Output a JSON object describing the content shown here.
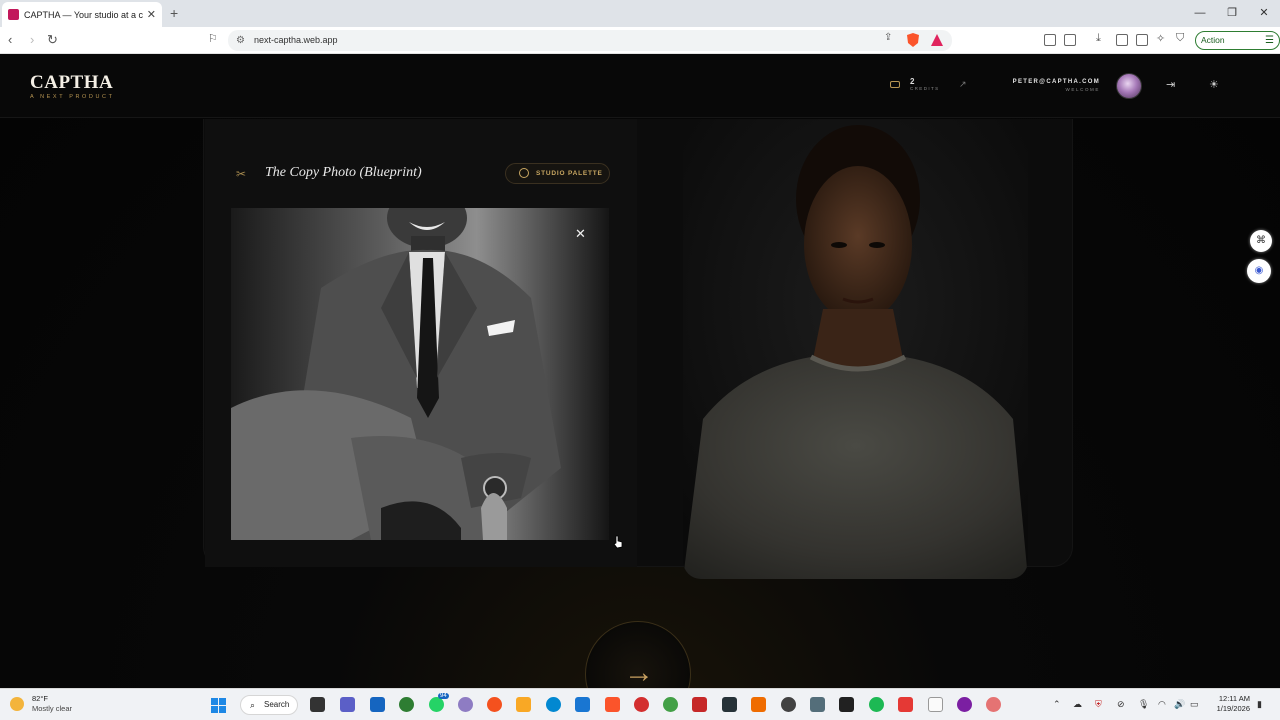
{
  "browser": {
    "tab_title": "CAPTHA — Your studio at a click",
    "url": "next-captha.web.app",
    "action_required": "Action required"
  },
  "header": {
    "logo": "CAPTHA",
    "tagline": "A NEXT PRODUCT",
    "credits_count": "2",
    "credits_label": "CREDITS",
    "user_email": "PETER@CAPTHA.COM",
    "user_greeting": "WELCOME"
  },
  "workspace": {
    "card_title": "The Copy Photo (Blueprint)",
    "palette_button": "STUDIO PALETTE"
  },
  "taskbar": {
    "temperature": "82°F",
    "condition": "Mostly clear",
    "search": "Search",
    "time": "12:11 AM",
    "date": "1/19/2026",
    "whatsapp_badge": "94"
  },
  "colors": {
    "accent_gold": "#c8a762",
    "background": "#050505"
  },
  "icons": [
    "back-icon",
    "forward-icon",
    "reload-icon",
    "bookmark-icon",
    "share-icon",
    "brave-shield-icon",
    "scissors-icon",
    "palette-icon",
    "close-icon",
    "arrow-right-icon",
    "logout-icon",
    "sun-icon",
    "credits-icon",
    "external-link-icon"
  ]
}
